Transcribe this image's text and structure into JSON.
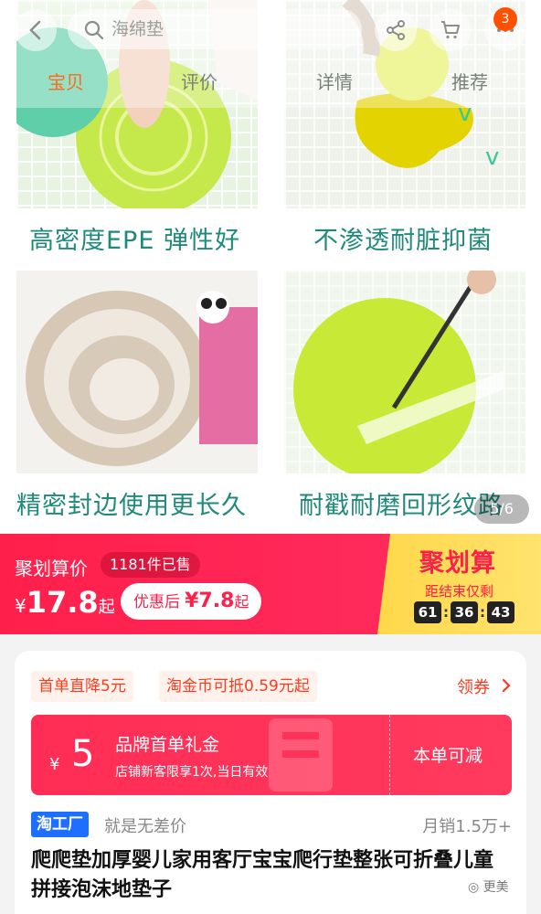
{
  "header": {
    "search_placeholder": "海绵垫",
    "cart_badge": "3"
  },
  "tabs": [
    {
      "label": "宝贝",
      "active": true
    },
    {
      "label": "评价",
      "active": false
    },
    {
      "label": "详情",
      "active": false
    },
    {
      "label": "推荐",
      "active": false
    }
  ],
  "gallery": {
    "captions": [
      "高密度EPE 弹性好",
      "不渗透耐脏抑菌",
      "精密封边使用更长久",
      "耐戳耐磨回形纹路"
    ],
    "pager": "5/6"
  },
  "price_banner": {
    "label": "聚划算价",
    "sold": "1181件已售",
    "currency": "¥",
    "price": "17.8",
    "price_suffix": "起",
    "coupon_label": "优惠后",
    "coupon_price": "¥7.8",
    "coupon_suffix": "起",
    "jhs_logo": "聚划算",
    "jhs_sub": "距结束仅剩",
    "countdown": {
      "hours": "61",
      "minutes": "36",
      "seconds": "43"
    }
  },
  "coupons": {
    "chip_1": "首单直降5元",
    "chip_2": "淘金币可抵0.59元起",
    "get_label": "领券"
  },
  "gift_card": {
    "currency": "¥",
    "amount": "5",
    "title": "品牌首单礼金",
    "subtitle": "店铺新客限享1次,当日有效",
    "action": "本单可减"
  },
  "product": {
    "brand_badge": "淘工厂",
    "slogan": "就是无差价",
    "monthly_sales": "月销1.5万+",
    "title": "爬爬垫加厚婴儿家用客厅宝宝爬行垫整张可折叠儿童拼接泡沫地垫子"
  },
  "watermark": "更美"
}
